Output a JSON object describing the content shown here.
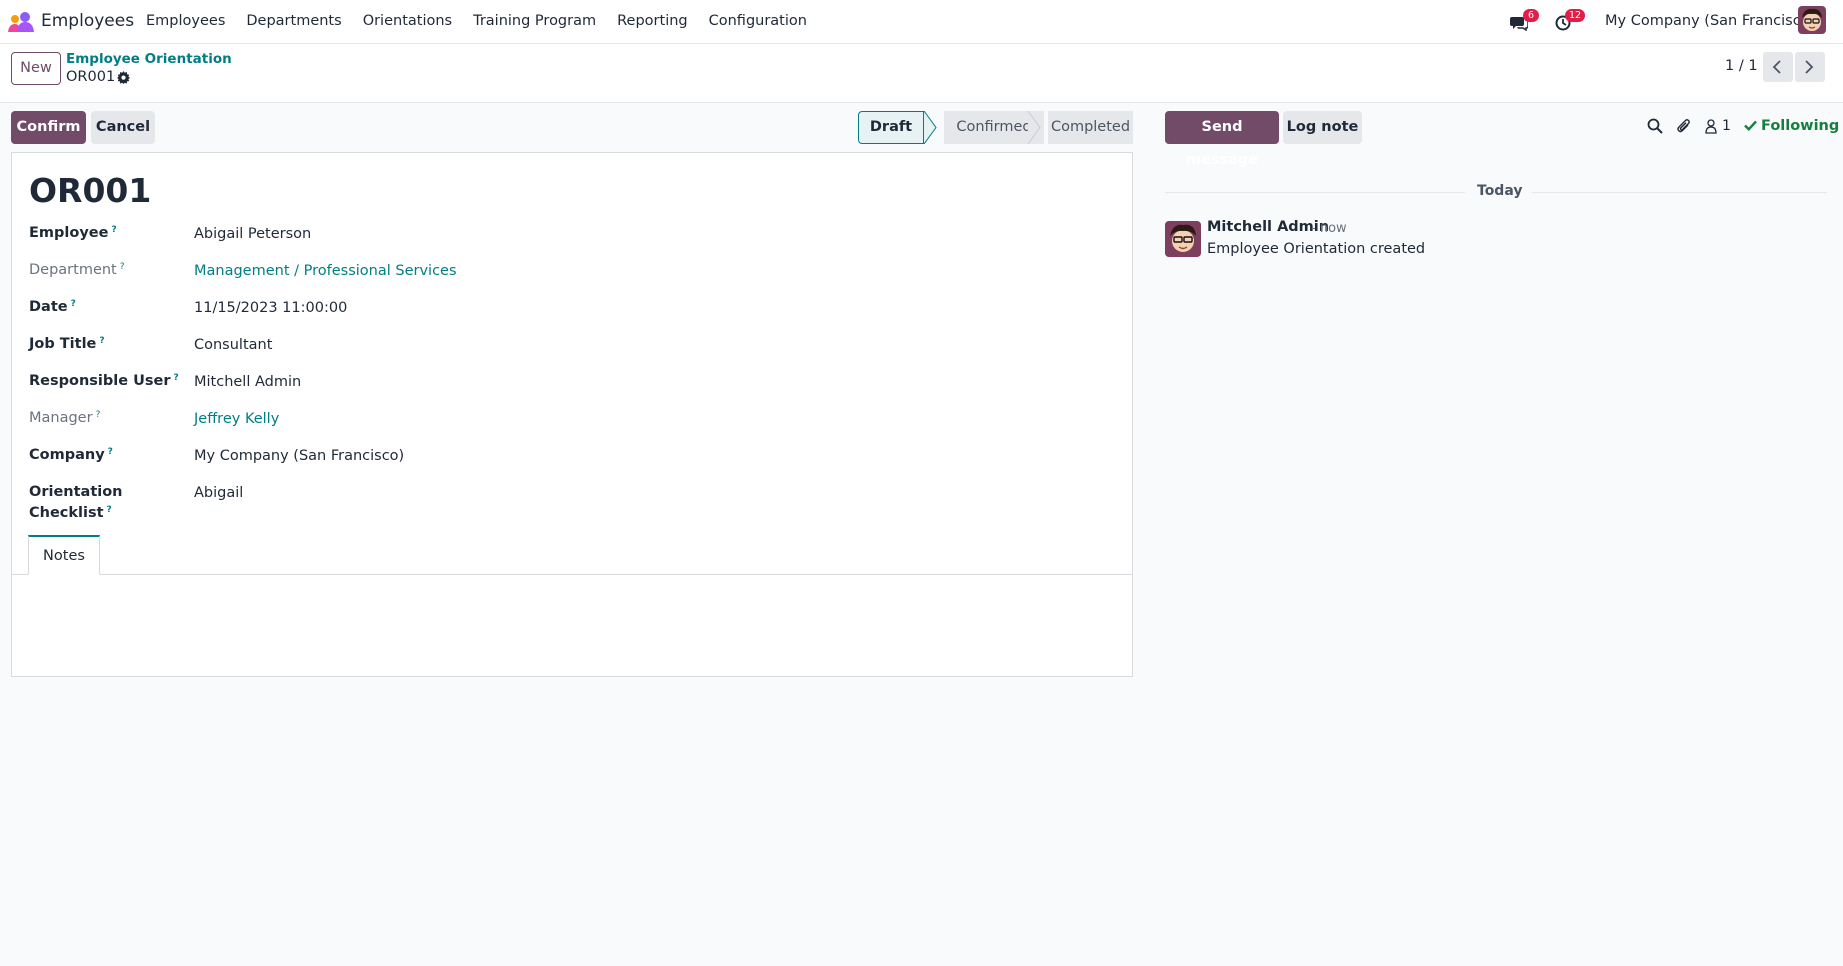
{
  "navbar": {
    "app_name": "Employees",
    "menu": [
      "Employees",
      "Departments",
      "Orientations",
      "Training Program",
      "Reporting",
      "Configuration"
    ],
    "messages_badge": "6",
    "activities_badge": "12",
    "company": "My Company (San Francisco)"
  },
  "control_panel": {
    "new_label": "New",
    "breadcrumb_parent": "Employee Orientation",
    "breadcrumb_current": "OR001",
    "pager": "1 / 1"
  },
  "actions": {
    "confirm": "Confirm",
    "cancel": "Cancel"
  },
  "statusbar": {
    "steps": [
      "Draft",
      "Confirmed",
      "Completed"
    ],
    "active": "Draft"
  },
  "form": {
    "name": "OR001",
    "fields": [
      {
        "label": "Employee",
        "value": "Abigail Peterson"
      },
      {
        "label": "Department",
        "value": "Management / Professional Services"
      },
      {
        "label": "Date",
        "value": "11/15/2023 11:00:00"
      },
      {
        "label": "Job Title",
        "value": "Consultant"
      },
      {
        "label": "Responsible User",
        "value": "Mitchell Admin"
      },
      {
        "label": "Manager",
        "value": "Jeffrey Kelly"
      },
      {
        "label": "Company",
        "value": "My Company (San Francisco)"
      },
      {
        "label_line1": "Orientation",
        "label_line2": "Checklist",
        "value": "Abigail"
      }
    ],
    "help_mark": "?",
    "tab_notes": "Notes"
  },
  "chatter": {
    "send_message": "Send message",
    "log_note": "Log note",
    "followers_count": "1",
    "following": "Following",
    "date_separator": "Today",
    "message": {
      "author": "Mitchell Admin",
      "time": "- now",
      "body": "Employee Orientation created"
    }
  },
  "colors": {
    "brand": "#714b67",
    "accent": "#017e84",
    "badge": "#e11d48",
    "following": "#15803d"
  },
  "icons": [
    "employees-app-logo-icon",
    "chat-icon",
    "activity-clock-icon",
    "gear-icon",
    "chevron-left-icon",
    "chevron-right-icon",
    "search-icon",
    "paperclip-icon",
    "user-icon",
    "check-icon"
  ]
}
